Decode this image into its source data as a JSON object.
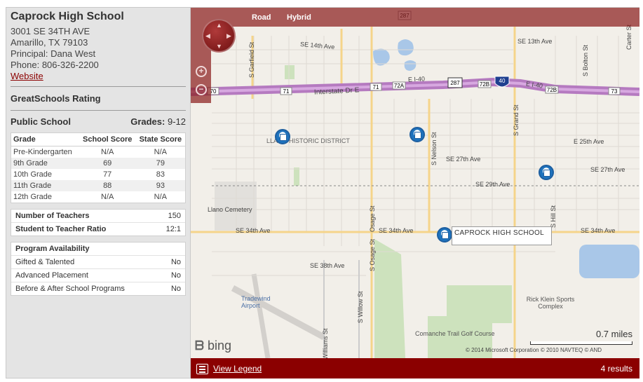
{
  "school": {
    "name": "Caprock High School",
    "address1": "3001 SE 34TH AVE",
    "address2": "Amarillo, TX 79103",
    "principal": "Principal: Dana West",
    "phone": "Phone: 806-326-2200",
    "website": "Website"
  },
  "rating_title": "GreatSchools Rating",
  "public": {
    "label": "Public School",
    "grades_label": "Grades:",
    "grades_value": "9-12"
  },
  "scores_table": {
    "headers": [
      "Grade",
      "School Score",
      "State Score"
    ],
    "rows": [
      [
        "Pre-Kindergarten",
        "N/A",
        "N/A"
      ],
      [
        "9th Grade",
        "69",
        "79"
      ],
      [
        "10th Grade",
        "77",
        "83"
      ],
      [
        "11th Grade",
        "88",
        "93"
      ],
      [
        "12th Grade",
        "N/A",
        "N/A"
      ]
    ]
  },
  "teachers": {
    "num_label": "Number of Teachers",
    "num_value": "150",
    "ratio_label": "Student to Teacher Ratio",
    "ratio_value": "12:1"
  },
  "programs": {
    "title": "Program Availability",
    "rows": [
      [
        "Gifted & Talented",
        "No"
      ],
      [
        "Advanced Placement",
        "No"
      ],
      [
        "Before & After School Programs",
        "No"
      ]
    ]
  },
  "map": {
    "tabs": [
      "Road",
      "Hybrid"
    ],
    "callout": "CAPROCK HIGH SCHOOL",
    "scale": "0.7 miles",
    "copyright": "© 2014 Microsoft Corporation   © 2010 NAVTEQ   © AND",
    "brand": "bing",
    "labels": {
      "se13": "SE 13th Ave",
      "se14": "SE 14th Ave",
      "interstate": "Interstate Dr E",
      "ei40a": "E I-40",
      "ei40b": "E I-40",
      "llano": "LLANO HISTORIC DISTRICT",
      "se25": "E 25th Ave",
      "se27a": "SE 27th Ave",
      "se27b": "SE 27th Ave",
      "se29": "SE 29th Ave",
      "llano_cem": "Llano Cemetery",
      "se34a": "SE 34th Ave",
      "se34b": "SE 34th Ave",
      "se34c": "SE 34th Ave",
      "se38": "SE 38th Ave",
      "tradewind": "Tradewind Airport",
      "rick": "Rick Klein Sports Complex",
      "comanche": "Comanche Trail Golf Course",
      "garfield": "S Garfield St",
      "nelson": "S Nelson St",
      "grand": "S Grand St",
      "bolton": "S Bolton St",
      "carter": "Carter St",
      "osage_a": "Osage St",
      "osage_b": "S Osage St",
      "willow": "S Willow St",
      "williams": "Williams St",
      "hills": "S Hill St"
    },
    "shields": [
      "70",
      "71",
      "71",
      "72A",
      "287",
      "72B",
      "40",
      "72B",
      "73",
      "287"
    ]
  },
  "footer": {
    "legend": "View Legend",
    "results": "4 results"
  },
  "colors": {
    "accent": "#8b0000",
    "bar": "#8b1e1e",
    "highway": "#b57ac0",
    "pin": "#1e73be"
  }
}
